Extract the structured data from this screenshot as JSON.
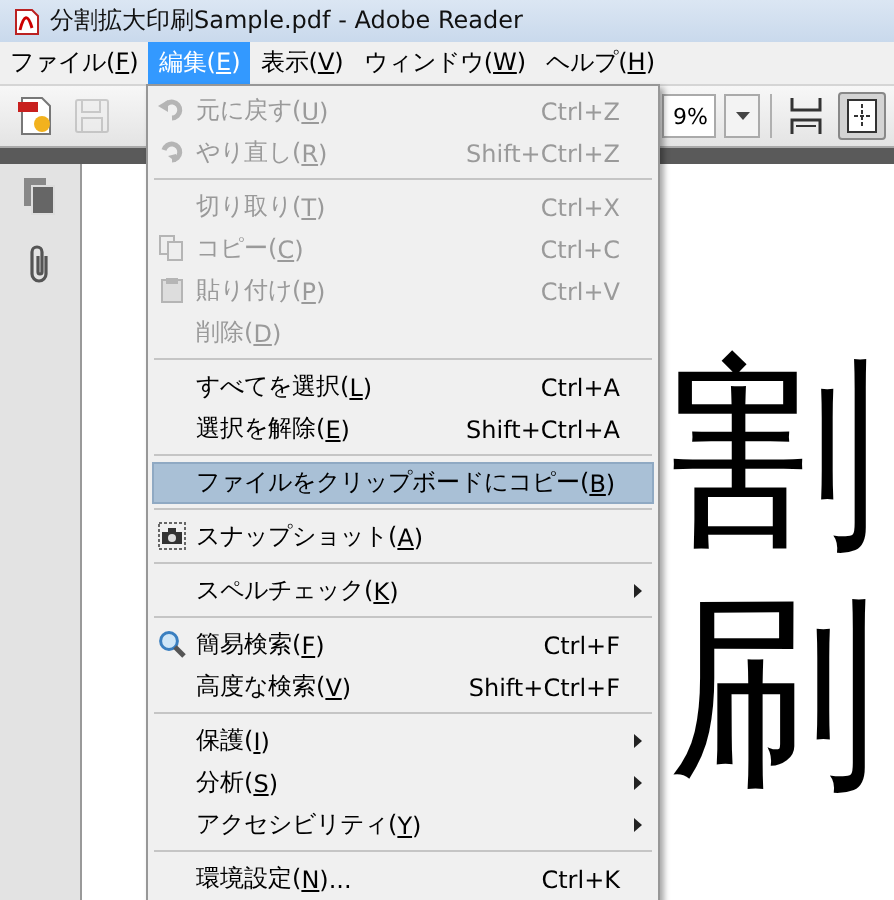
{
  "window": {
    "title": "分割拡大印刷Sample.pdf - Adobe Reader"
  },
  "menu_bar": [
    {
      "label": "ファイル(F)",
      "selected": false
    },
    {
      "label": "編集(E)",
      "selected": true
    },
    {
      "label": "表示(V)",
      "selected": false
    },
    {
      "label": "ウィンドウ(W)",
      "selected": false
    },
    {
      "label": "ヘルプ(H)",
      "selected": false
    }
  ],
  "toolbar": {
    "left_buttons": [
      {
        "kind": "create_pdf",
        "disabled": false
      },
      {
        "kind": "save",
        "disabled": true
      }
    ],
    "zoom_value": "9%",
    "right_buttons": [
      {
        "kind": "fit_width",
        "selected": false
      },
      {
        "kind": "fit_page",
        "selected": true
      }
    ]
  },
  "edit_menu": {
    "items": [
      {
        "kind": "undo",
        "label": "元に戻す(U)",
        "shortcut": "Ctrl+Z",
        "disabled": true,
        "selected": false
      },
      {
        "kind": "redo",
        "label": "やり直し(R)",
        "shortcut": "Shift+Ctrl+Z",
        "disabled": true,
        "selected": false
      },
      {
        "kind": "separator"
      },
      {
        "kind": "item",
        "label": "切り取り(T)",
        "shortcut": "Ctrl+X",
        "disabled": true,
        "selected": false
      },
      {
        "kind": "copy",
        "label": "コピー(C)",
        "shortcut": "Ctrl+C",
        "disabled": true,
        "selected": false
      },
      {
        "kind": "paste",
        "label": "貼り付け(P)",
        "shortcut": "Ctrl+V",
        "disabled": true,
        "selected": false
      },
      {
        "kind": "item",
        "label": "削除(D)",
        "disabled": true,
        "selected": false
      },
      {
        "kind": "separator"
      },
      {
        "kind": "item",
        "label": "すべてを選択(L)",
        "shortcut": "Ctrl+A",
        "disabled": false,
        "selected": false
      },
      {
        "kind": "item",
        "label": "選択を解除(E)",
        "shortcut": "Shift+Ctrl+A",
        "disabled": false,
        "selected": false
      },
      {
        "kind": "separator"
      },
      {
        "kind": "item",
        "label": "ファイルをクリップボードにコピー(B)",
        "disabled": false,
        "selected": true
      },
      {
        "kind": "separator"
      },
      {
        "kind": "camera",
        "label": "スナップショット(A)",
        "disabled": false,
        "selected": false
      },
      {
        "kind": "separator"
      },
      {
        "kind": "submenu",
        "label": "スペルチェック(K)",
        "disabled": false,
        "selected": false
      },
      {
        "kind": "separator"
      },
      {
        "kind": "search",
        "label": "簡易検索(F)",
        "shortcut": "Ctrl+F",
        "disabled": false,
        "selected": false
      },
      {
        "kind": "item",
        "label": "高度な検索(V)",
        "shortcut": "Shift+Ctrl+F",
        "disabled": false,
        "selected": false
      },
      {
        "kind": "separator"
      },
      {
        "kind": "submenu",
        "label": "保護(I)",
        "disabled": false,
        "selected": false
      },
      {
        "kind": "submenu",
        "label": "分析(S)",
        "disabled": false,
        "selected": false
      },
      {
        "kind": "submenu",
        "label": "アクセシビリティ(Y)",
        "disabled": false,
        "selected": false
      },
      {
        "kind": "separator"
      },
      {
        "kind": "item",
        "label": "環境設定(N)...",
        "shortcut": "Ctrl+K",
        "disabled": false,
        "selected": false
      }
    ]
  },
  "document": {
    "lines": [
      "割",
      "刷"
    ]
  }
}
